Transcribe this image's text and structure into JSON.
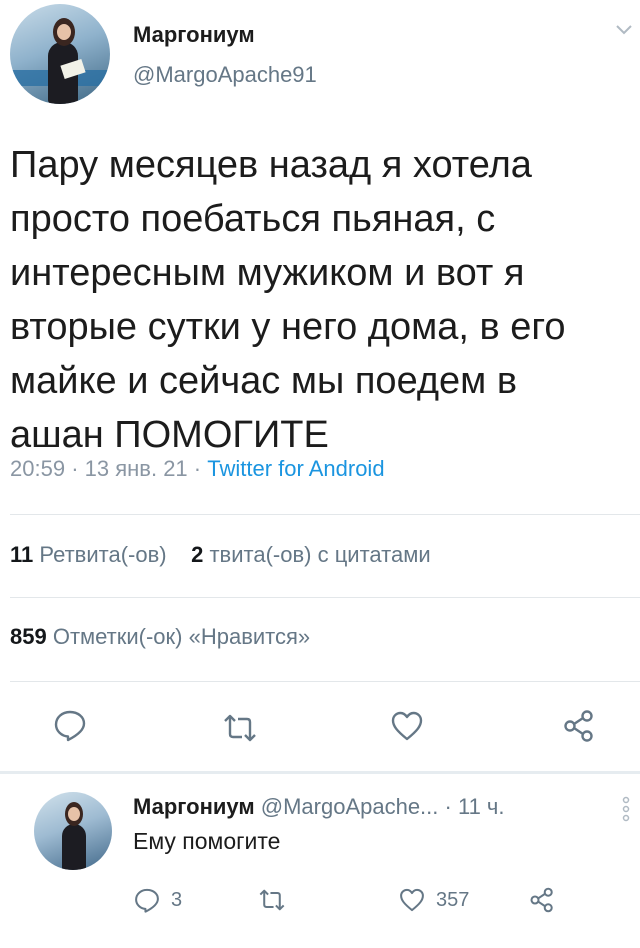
{
  "tweet": {
    "display_name": "Маргониум",
    "handle": "@MargoApache91",
    "text_lines": [
      "Пару месяцев назад я хотела",
      "просто поебаться пьяная, с",
      "интересным мужиком и вот я",
      "вторые сутки у него дома, в его",
      "майке и сейчас мы поедем в",
      "ашан ПОМОГИТЕ"
    ],
    "time": "20:59",
    "date": "13 янв. 21",
    "separator": "·",
    "source": "Twitter for Android"
  },
  "stats": {
    "retweets_count": "11",
    "retweets_label": "Ретвита(-ов)",
    "quotes_count": "2",
    "quotes_label": "твита(-ов) с цитатами",
    "likes_count": "859",
    "likes_label": "Отметки(-ок) «Нравится»"
  },
  "actions": {
    "reply_icon": "reply-icon",
    "retweet_icon": "retweet-icon",
    "like_icon": "heart-icon",
    "share_icon": "share-icon"
  },
  "reply": {
    "display_name": "Маргониум",
    "handle": "@MargoApache...",
    "time": "· 11 ч.",
    "text": "Ему помогите",
    "reply_count": "3",
    "like_count": "357"
  },
  "colors": {
    "accent": "#1b95e0",
    "muted": "#657786",
    "text": "#14171a",
    "divider": "#e3e7ea"
  }
}
